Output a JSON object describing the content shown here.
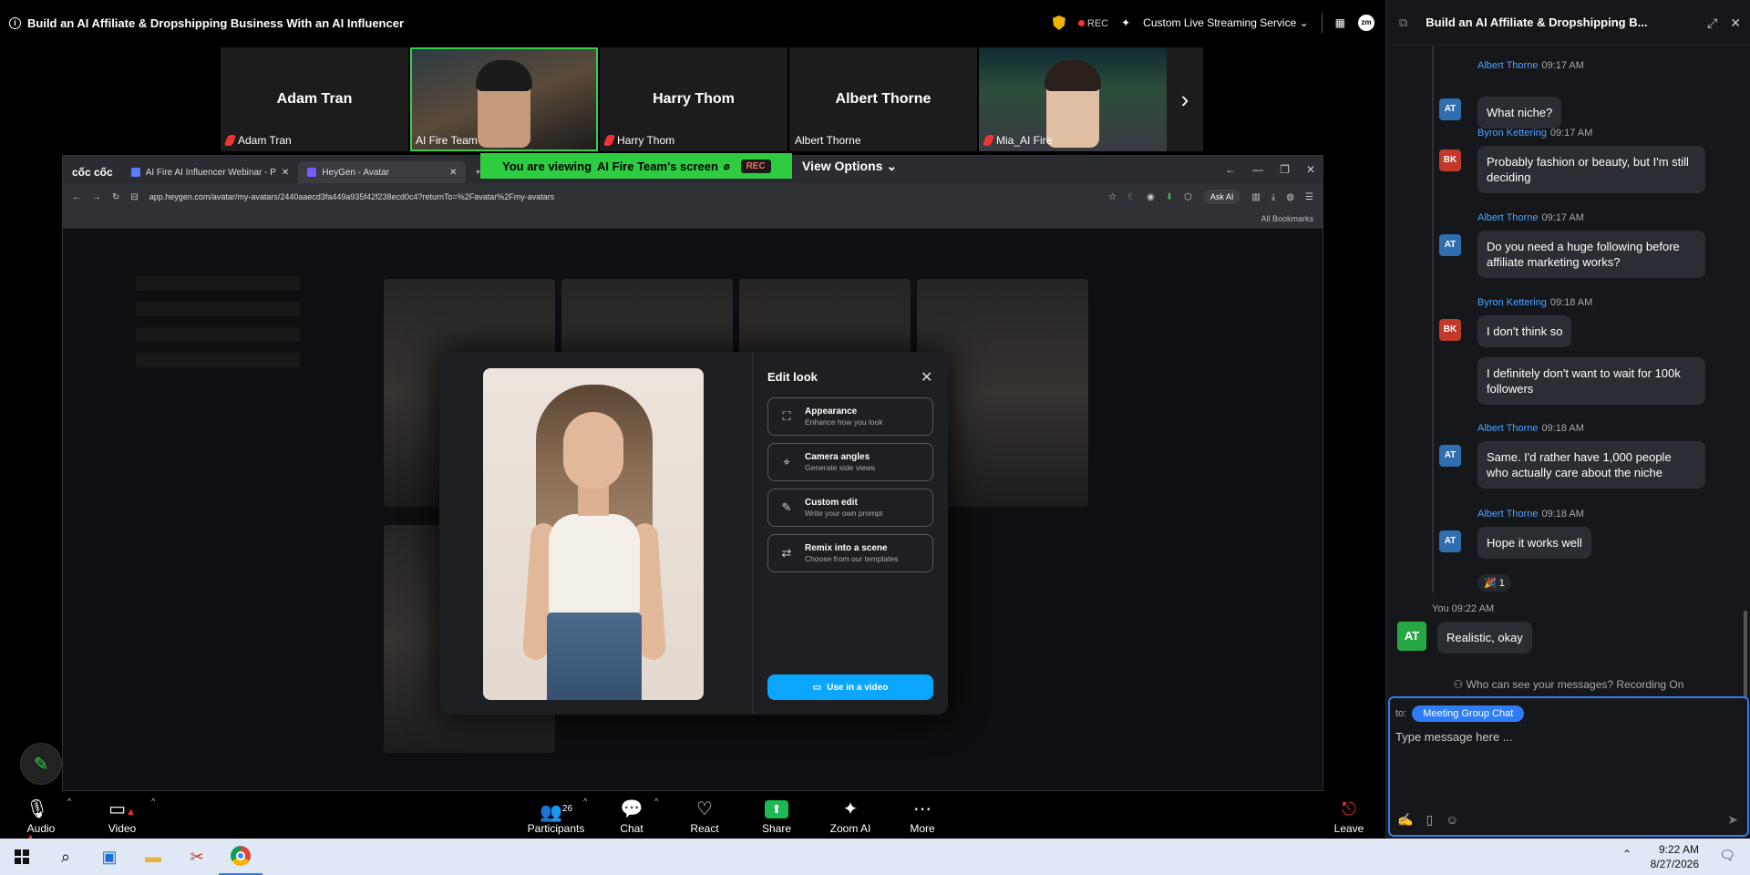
{
  "meeting": {
    "title": "Build an AI Affiliate & Dropshipping Business With an AI Influencer",
    "rec_label": "REC",
    "streaming_label": "Custom Live Streaming Service",
    "zoom_logo": "zm"
  },
  "gallery": {
    "tiles": [
      {
        "big_name": "Adam Tran",
        "label": "Adam Tran",
        "muted": true
      },
      {
        "big_name": "",
        "label": "AI Fire Team",
        "muted": false,
        "active": true
      },
      {
        "big_name": "Harry Thom",
        "label": "Harry Thom",
        "muted": true
      },
      {
        "big_name": "Albert Thorne",
        "label": "Albert Thorne",
        "muted": false
      },
      {
        "big_name": "",
        "label": "Mia_AI Fire",
        "muted": true
      }
    ]
  },
  "share_banner": {
    "prefix": "You are viewing",
    "who": "AI Fire Team's screen",
    "rec": "REC",
    "view_options": "View Options"
  },
  "browser": {
    "brand": "cốc cốc",
    "tabs": [
      {
        "label": "AI Fire AI Influencer Webinar - P"
      },
      {
        "label": "HeyGen - Avatar"
      }
    ],
    "url": "app.heygen.com/avatar/my-avatars/2440aaecd3fa449a935f42f238ecd0c4?returnTo=%2Favatar%2Fmy-avatars",
    "ask_ai": "Ask AI",
    "bookmarks": "All Bookmarks"
  },
  "modal": {
    "title": "Edit look",
    "options": [
      {
        "title": "Appearance",
        "subtitle": "Enhance how you look",
        "icon": "sparkle-frame-icon"
      },
      {
        "title": "Camera angles",
        "subtitle": "Generate side views",
        "icon": "camera-angle-icon"
      },
      {
        "title": "Custom edit",
        "subtitle": "Write your own prompt",
        "icon": "pen-icon"
      },
      {
        "title": "Remix into a scene",
        "subtitle": "Choose from our templates",
        "icon": "swap-icon"
      }
    ],
    "cta": "Use in a video"
  },
  "toolbar": {
    "audio": "Audio",
    "video": "Video",
    "participants": "Participants",
    "participants_count": "26",
    "chat": "Chat",
    "react": "React",
    "share": "Share",
    "zoom_ai": "Zoom AI",
    "more": "More",
    "leave": "Leave"
  },
  "chat": {
    "title": "Build an AI Affiliate & Dropshipping B...",
    "messages": [
      {
        "sender": "Albert Thorne",
        "time": "09:17 AM",
        "initials": "AT",
        "text": "What niche?"
      },
      {
        "sender": "Byron Kettering",
        "time": "09:17 AM",
        "initials": "BK",
        "text": "Probably fashion or beauty, but I'm still deciding"
      },
      {
        "sender": "Albert Thorne",
        "time": "09:17 AM",
        "initials": "AT",
        "text": "Do you need a huge following before affiliate marketing works?"
      },
      {
        "sender": "Byron Kettering",
        "time": "09:18 AM",
        "initials": "BK",
        "text": "I don't think so"
      },
      {
        "sender": "",
        "time": "",
        "initials": "",
        "text": "I definitely don't want to wait for 100k followers"
      },
      {
        "sender": "Albert Thorne",
        "time": "09:18 AM",
        "initials": "AT",
        "text": "Same. I'd rather have 1,000 people who actually care about the niche"
      },
      {
        "sender": "Albert Thorne",
        "time": "09:18 AM",
        "initials": "AT",
        "text": "Hope it works well"
      }
    ],
    "reaction": "🎉 1",
    "me": {
      "label": "You",
      "time": "09:22 AM",
      "initials": "AT",
      "text": "Realistic, okay"
    },
    "who_can_see": "Who can see your messages? Recording On",
    "to_label": "to:",
    "recipient": "Meeting Group Chat",
    "placeholder": "Type message here ..."
  },
  "taskbar": {
    "time": "9:22 AM",
    "date": "8/27/2026"
  }
}
